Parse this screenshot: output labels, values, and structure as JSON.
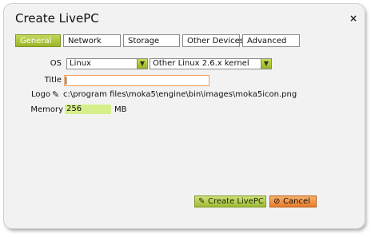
{
  "dialog": {
    "title": "Create LivePC",
    "close_glyph": "×"
  },
  "tabs": [
    {
      "label": "General",
      "active": true
    },
    {
      "label": "Network",
      "active": false
    },
    {
      "label": "Storage",
      "active": false
    },
    {
      "label": "Other Devices",
      "active": false
    },
    {
      "label": "Advanced",
      "active": false
    }
  ],
  "form": {
    "os_label": "OS",
    "os_value": "Linux",
    "os_version_value": "Other Linux 2.6.x kernel",
    "title_label": "Title",
    "title_value": "",
    "logo_label": "Logo",
    "logo_icon": "pencil-icon",
    "logo_path": "c:\\program files\\moka5\\engine\\bin\\images\\moka5icon.png",
    "memory_label": "Memory",
    "memory_value": "256",
    "memory_unit": "MB"
  },
  "buttons": {
    "create_label": "Create LivePC",
    "create_icon": "pencil-icon",
    "cancel_label": "Cancel",
    "cancel_icon": "cancel-icon"
  },
  "colors": {
    "accent_green": "#9fbb34",
    "accent_orange": "#e67c2a",
    "memory_highlight": "#d6ef8a",
    "input_border": "#f0a15e"
  }
}
